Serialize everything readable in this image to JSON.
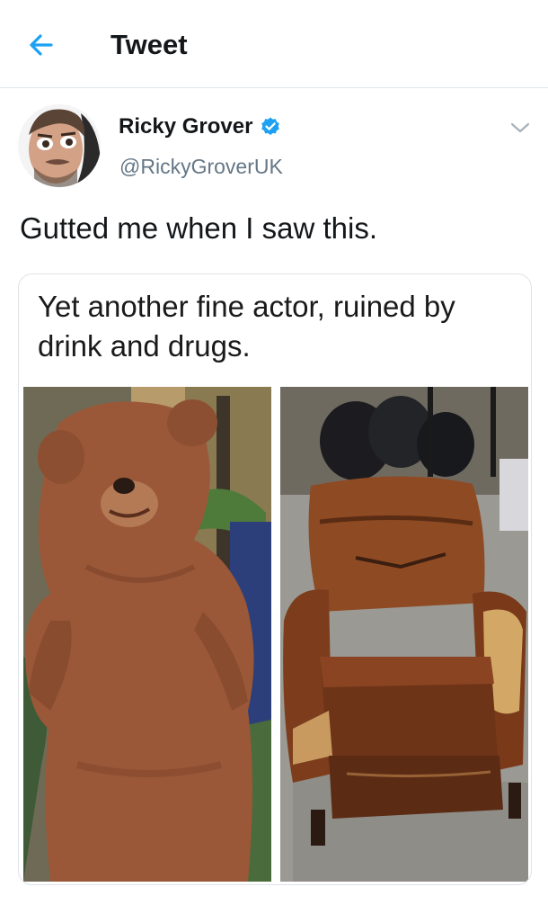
{
  "header": {
    "title": "Tweet",
    "back_icon": "arrow-left-icon",
    "accent_color": "#1da1f2"
  },
  "tweet": {
    "author": {
      "name": "Ricky Grover",
      "handle": "@RickyGroverUK",
      "verified": true,
      "verified_icon": "verified-badge-icon"
    },
    "menu_icon": "chevron-down-icon",
    "text": "Gutted me when I saw this.",
    "media": {
      "caption": "Yet another fine actor, ruined by drink and drugs.",
      "left_image": "brown-teddy-bear-costume",
      "right_image": "worn-leather-armchair"
    }
  }
}
